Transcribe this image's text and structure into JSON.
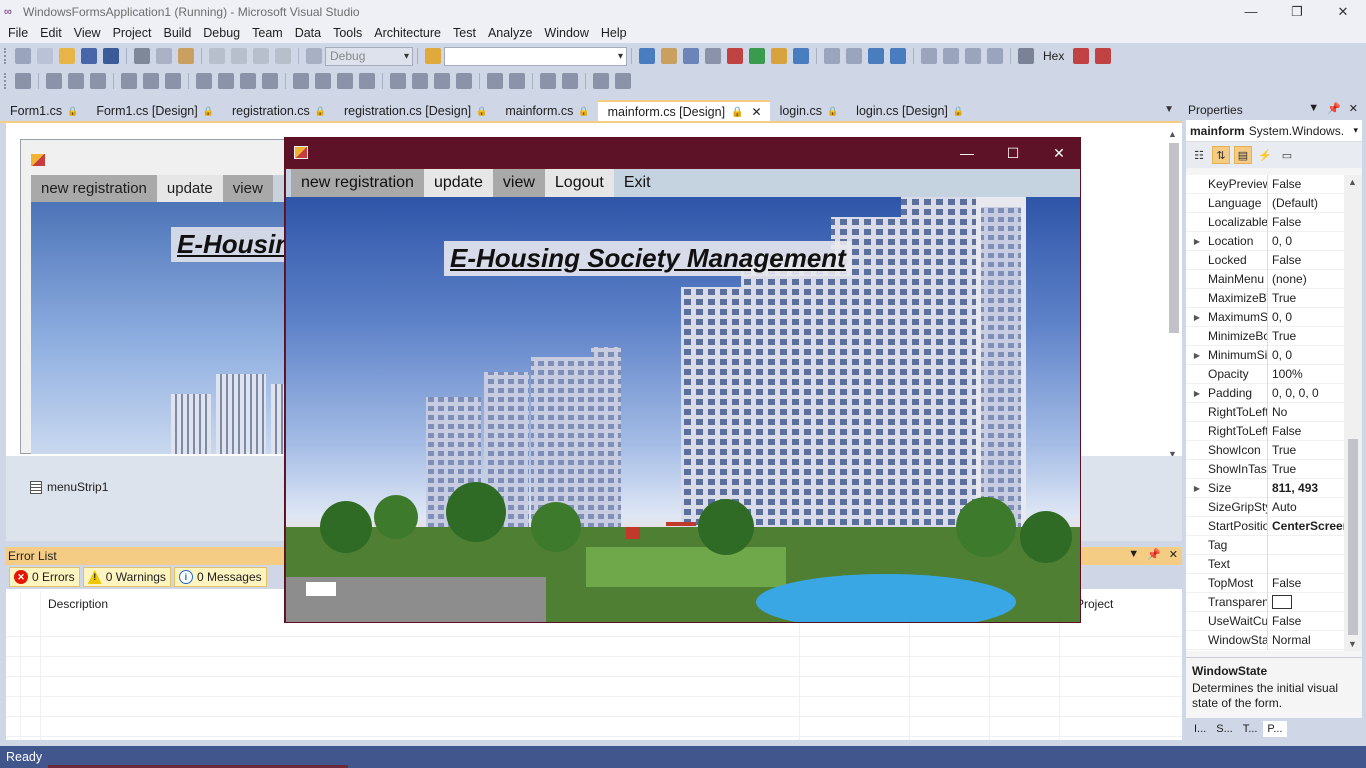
{
  "window": {
    "title": "WindowsFormsApplication1 (Running) - Microsoft Visual Studio",
    "minimize": "—",
    "restore": "❐",
    "close": "✕"
  },
  "menu": [
    "File",
    "Edit",
    "View",
    "Project",
    "Build",
    "Debug",
    "Team",
    "Data",
    "Tools",
    "Architecture",
    "Test",
    "Analyze",
    "Window",
    "Help"
  ],
  "toolbar": {
    "config": "Debug",
    "platform": "",
    "hex": "Hex"
  },
  "tabs": [
    {
      "label": "Form1.cs"
    },
    {
      "label": "Form1.cs [Design]"
    },
    {
      "label": "registration.cs"
    },
    {
      "label": "registration.cs [Design]"
    },
    {
      "label": "mainform.cs"
    },
    {
      "label": "mainform.cs [Design]",
      "active": true
    },
    {
      "label": "login.cs"
    },
    {
      "label": "login.cs [Design]"
    }
  ],
  "designer": {
    "menu": [
      "new registration",
      "update",
      "view"
    ],
    "heading": "E-Housing Society Management",
    "tray_item": "menuStrip1"
  },
  "error_list": {
    "title": "Error List",
    "errors": "0 Errors",
    "warnings": "0 Warnings",
    "messages": "0 Messages",
    "col_description": "Description",
    "col_project": "Project"
  },
  "properties": {
    "title": "Properties",
    "object_name": "mainform",
    "object_type": "System.Windows.",
    "rows": [
      {
        "name": "KeyPreview",
        "value": "False",
        "exp": false
      },
      {
        "name": "Language",
        "value": "(Default)",
        "exp": false
      },
      {
        "name": "Localizable",
        "value": "False",
        "exp": false
      },
      {
        "name": "Location",
        "value": "0, 0",
        "exp": true
      },
      {
        "name": "Locked",
        "value": "False",
        "exp": false
      },
      {
        "name": "MainMenu",
        "value": "(none)",
        "exp": false
      },
      {
        "name": "MaximizeBox",
        "value": "True",
        "exp": false
      },
      {
        "name": "MaximumSize",
        "value": "0, 0",
        "exp": true
      },
      {
        "name": "MinimizeBox",
        "value": "True",
        "exp": false
      },
      {
        "name": "MinimumSize",
        "value": "0, 0",
        "exp": true
      },
      {
        "name": "Opacity",
        "value": "100%",
        "exp": false
      },
      {
        "name": "Padding",
        "value": "0, 0, 0, 0",
        "exp": true
      },
      {
        "name": "RightToLeft",
        "value": "No",
        "exp": false
      },
      {
        "name": "RightToLeftLayout",
        "value": "False",
        "exp": false
      },
      {
        "name": "ShowIcon",
        "value": "True",
        "exp": false
      },
      {
        "name": "ShowInTaskbar",
        "value": "True",
        "exp": false
      },
      {
        "name": "Size",
        "value": "811, 493",
        "exp": true,
        "bold": true
      },
      {
        "name": "SizeGripStyle",
        "value": "Auto",
        "exp": false
      },
      {
        "name": "StartPosition",
        "value": "CenterScreen",
        "exp": false,
        "bold": true
      },
      {
        "name": "Tag",
        "value": "",
        "exp": false
      },
      {
        "name": "Text",
        "value": "",
        "exp": false
      },
      {
        "name": "TopMost",
        "value": "False",
        "exp": false
      },
      {
        "name": "TransparencyKey",
        "value": "",
        "exp": false,
        "color": true
      },
      {
        "name": "UseWaitCursor",
        "value": "False",
        "exp": false
      },
      {
        "name": "WindowState",
        "value": "Normal",
        "exp": false
      }
    ],
    "desc_title": "WindowState",
    "desc_text": "Determines the initial visual state of the form.",
    "bottom_tabs": [
      "I...",
      "S...",
      "T...",
      "P..."
    ]
  },
  "status": "Ready",
  "running_form": {
    "menu": [
      {
        "label": "new registration",
        "style": "g"
      },
      {
        "label": "update",
        "style": "w"
      },
      {
        "label": "view",
        "style": "g"
      },
      {
        "label": "Logout",
        "style": "w"
      },
      {
        "label": "Exit",
        "style": "n"
      }
    ],
    "heading": "E-Housing Society Management",
    "minimize": "—",
    "maximize": "☐",
    "close": "✕"
  },
  "colors": {
    "accent": "#f5cc84",
    "status_bar": "#40568d",
    "running_title": "#5e1227"
  }
}
